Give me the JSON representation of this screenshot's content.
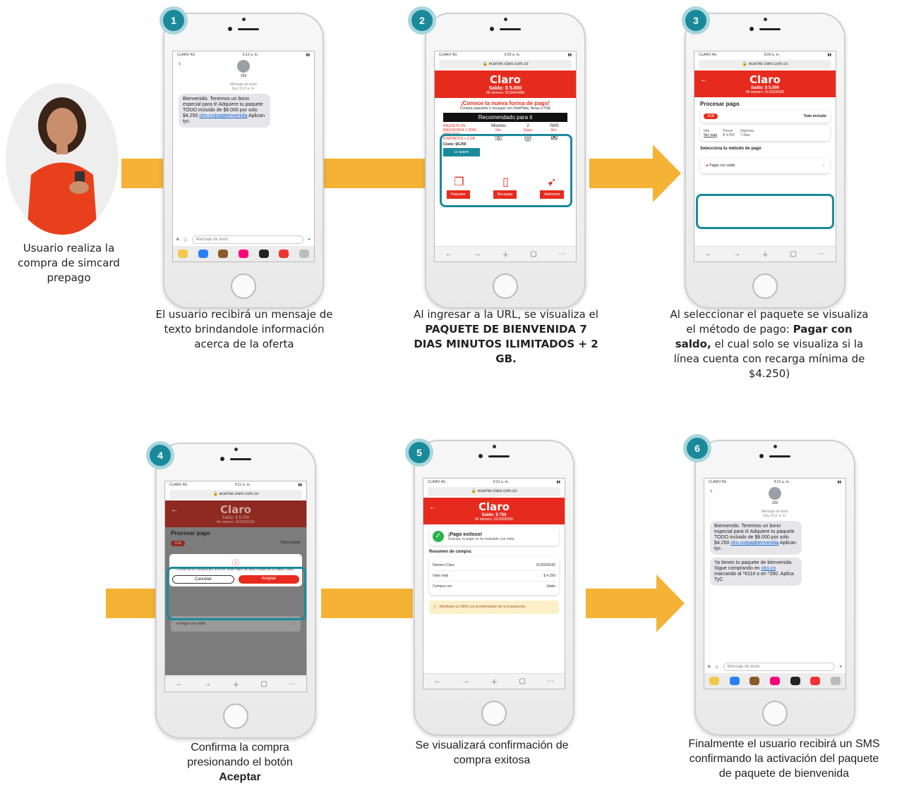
{
  "user_caption": "Usuario realiza  la compra de simcard prepago",
  "steps": [
    {
      "num": "1",
      "caption": "El usuario recibirá un mensaje de texto brindandole información acerca de la oferta"
    },
    {
      "num": "2",
      "caption_pre": "Al ingresar a la URL, se visualiza el",
      "caption_bold": "PAQUETE DE BIENVENIDA 7 DIAS MINUTOS ILIMITADOS + 2 GB."
    },
    {
      "num": "3",
      "caption_pre": "Al seleccionar el paquete se visualiza el método de pago:",
      "caption_bold": "Pagar con saldo,",
      "caption_post": "el cual solo se visualiza si la línea cuenta con recarga mínima de $4.250)"
    },
    {
      "num": "4",
      "caption_pre": "Confirma la compra presionando el botón",
      "caption_bold": "Aceptar"
    },
    {
      "num": "5",
      "caption": "Se visualizará confirmación de compra exitosa"
    },
    {
      "num": "6",
      "caption": "Finalmente el usuario recibirá un SMS confirmando la activación del paquete de paquete de bienvenida"
    }
  ],
  "sms": {
    "status_left": "CLARO 4G",
    "time1": "9:12 a. m.",
    "time6": "9:21 a. m.",
    "contact": "259",
    "header": "Mensaje de texto",
    "header_time": "hoy, 9:12 a. m.",
    "msg1_text": "Bienvenido. Tenemos un bono especial para ti! Adquiere tu paquete TODO incluido de $8.000 por solo $4.250",
    "msg1_link": "clro.co/paqbienvenida",
    "msg1_tail": "Aplican tyc.",
    "msg2_text": "Ya tienes tu paquete de bienvenida. Sigue comprando en",
    "msg2_link": "clro.co",
    "msg2_tail": "marcando al *611# o en *260. Aplica TyC",
    "input_placeholder": "Mensaje de texto"
  },
  "web": {
    "url": "ecarrier.claro.com.co",
    "brand": "Claro",
    "time2": "9:20 a. m.",
    "time4": "9:21 a. m.",
    "saldo": "Saldo: $ 5.000",
    "saldo_after": "Saldo: $ 750",
    "mi_numero": "Mi número: 3115644068",
    "mi_numero2": "Mi número: 3115926026",
    "promo_title": "¡Conoce la nueva forma de pago!",
    "promo_sub": "Compra paquetes o recargas con DaviPlata, Nequi o PSE",
    "recomendado": "Recomendado para ti",
    "pkg_name": "PAQUETE DE BIENVENIDA 7 DÍAS MINUTOS ILIMITADOS + 2 GB",
    "pkg_cost": "Costo: $4.250",
    "col_minutos": "Minutos",
    "col_minutos_val": "Ilim.",
    "col_gigas": "2",
    "col_gigas_val": "Gigas",
    "col_sms": "SMS",
    "col_sms_val": "Ilim.",
    "lo_quiero": "Lo quiero",
    "nav": [
      "Paquetes",
      "Recargas",
      "Adelantos"
    ],
    "procesar": "Procesar pago",
    "chip": "2GB",
    "todo_incluido": "Todo incluido",
    "info": "Info",
    "ver_mas": "Ver más",
    "precio": "Precio",
    "precio_val": "$ 4.250",
    "vigencia": "Vigencia",
    "vigencia_val": "7 días",
    "selecciona": "Selecciona tu método de pago",
    "pagar_con_saldo": "Pagar con saldo",
    "confirm_text": "Confirma tu compra por $ 4250. Este valor se descontará de tu saldo Claro.",
    "cancelar": "Cancelar",
    "aceptar": "Aceptar",
    "pago_exitoso": "¡Pago exitoso!",
    "pago_msg": "Gracias, tu pago se ha realizado con éxito.",
    "resumen": "Resumen de compra:",
    "numero_claro": "Número Claro",
    "numero_val": "3115926026",
    "valor_total": "Valor total",
    "valor_val": "$ 4.250",
    "compra_con": "Compra con",
    "compra_val": "Saldo",
    "recibiras": "Recibirás un SMS con la información de tu transacción."
  },
  "colors": {
    "red": "#e62b1e",
    "teal": "#1a8a9a",
    "arrow": "#f5b335"
  }
}
